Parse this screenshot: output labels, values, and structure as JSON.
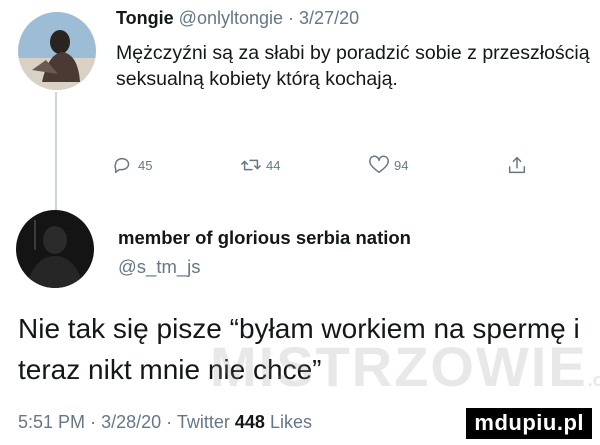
{
  "tweet1": {
    "name": "Tongie",
    "handle": "@onlyltongie",
    "separator": "·",
    "date": "3/27/20",
    "text": "Mężczyźni są za słabi by poradzić sobie z przeszłością seksualną kobiety którą kochają.",
    "actions": {
      "reply_count": "45",
      "retweet_count": "44",
      "like_count": "94"
    },
    "icons": [
      "reply-icon",
      "retweet-icon",
      "like-icon",
      "share-icon"
    ]
  },
  "tweet2": {
    "name": "member of glorious serbia nation",
    "handle": "@s_tm_js",
    "text": "Nie tak się pisze “byłam workiem na spermę i teraz nikt mnie nie chce”",
    "time": "5:51 PM",
    "sep1": "·",
    "date": "3/28/20",
    "sep2": "·",
    "source": "Twitter",
    "likes_count": "448",
    "likes_label": "Likes"
  },
  "watermark": {
    "text": "MISTRZOWIE",
    "suffix": ".org"
  },
  "brand": {
    "text": "mdupiu.pl"
  },
  "colors": {
    "text": "#14171a",
    "secondary": "#657786",
    "line": "#ccd6dd"
  }
}
